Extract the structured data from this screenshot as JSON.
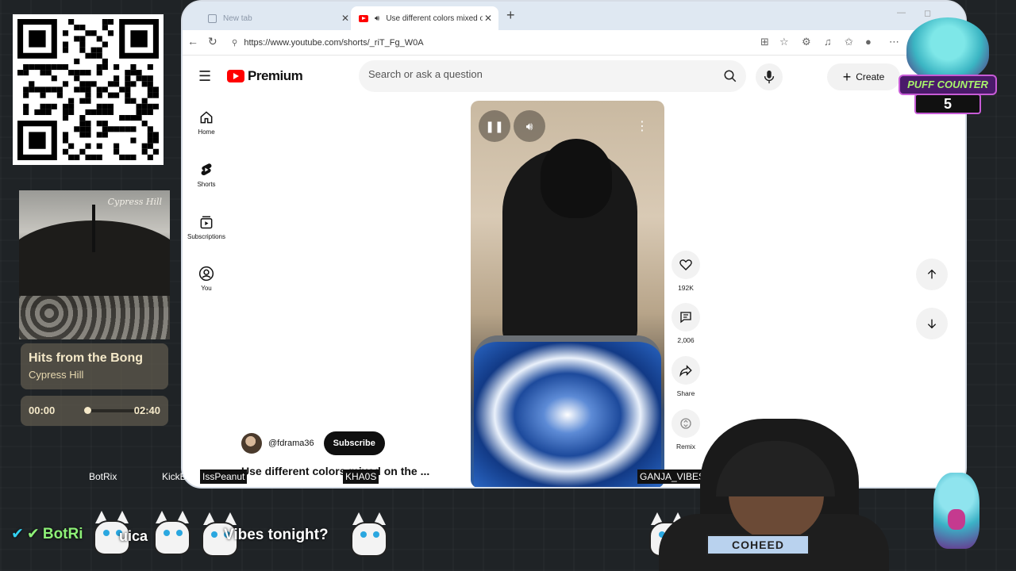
{
  "browser": {
    "tabs": [
      {
        "label": "New tab",
        "active": false
      },
      {
        "label": "Use different colors mixed on",
        "active": true
      }
    ],
    "url": "https://www.youtube.com/shorts/_riT_Fg_W0A"
  },
  "youtube": {
    "logo_text": "Premium",
    "search_placeholder": "Search or ask a question",
    "create_label": "Create",
    "sidebar": [
      {
        "label": "Home",
        "icon": "home-icon"
      },
      {
        "label": "Shorts",
        "icon": "shorts-icon"
      },
      {
        "label": "Subscriptions",
        "icon": "subscriptions-icon"
      },
      {
        "label": "You",
        "icon": "account-icon"
      }
    ],
    "actions": {
      "like_count": "192K",
      "comment_count": "2,006",
      "share_label": "Share",
      "remix_label": "Remix"
    },
    "channel": {
      "handle": "@fdrama36",
      "subscribe_label": "Subscribe"
    },
    "short_title": "Use different colors mixed on the ..."
  },
  "overlay": {
    "now_playing": {
      "title": "Hits from the Bong",
      "artist": "Cypress Hill",
      "current_time": "00:00",
      "total_time": "02:40",
      "progress": 0.0
    },
    "album_brand": "Cypress Hill",
    "puff_counter": {
      "label": "PUFF COUNTER",
      "count": "5"
    },
    "chat": {
      "names": [
        "BotRix",
        "KickBot",
        "IssPeanut",
        "KHA0S",
        "GANJA_VIBES"
      ],
      "line_prefix": "BotRi",
      "fragment": "uica",
      "message": "Vibes tonight?"
    },
    "shirt_print": "COHEED"
  },
  "colors": {
    "youtube_red": "#ff0000",
    "subscribe_bg": "#0f0f0f",
    "overlay_text": "#f5e9c9"
  }
}
